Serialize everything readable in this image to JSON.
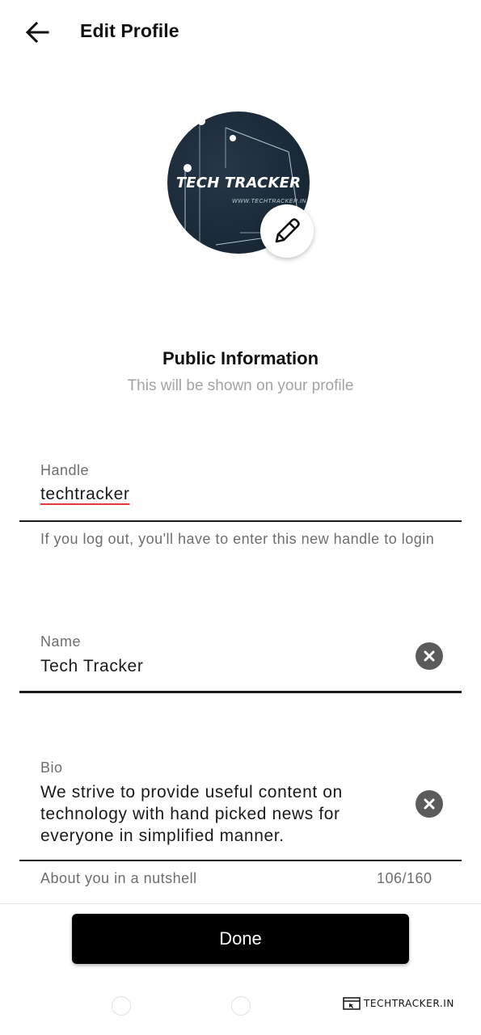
{
  "header": {
    "title": "Edit Profile",
    "back_icon": "arrow-left-icon"
  },
  "avatar": {
    "brand_text": "TECH TRACKER",
    "url_text": "WWW.TECHTRACKER.IN",
    "edit_icon": "pencil-icon"
  },
  "public_info": {
    "title": "Public Information",
    "subtitle": "This will be shown on your profile"
  },
  "handle": {
    "label": "Handle",
    "value": "techtracker",
    "helper": "If you log out, you'll have to enter this new handle to login"
  },
  "name": {
    "label": "Name",
    "value": "Tech Tracker",
    "clear_icon": "clear-icon"
  },
  "bio": {
    "label": "Bio",
    "value": "We strive to provide useful content on technology with hand picked news for everyone in simplified manner.",
    "helper": "About you in a nutshell",
    "counter": "106/160",
    "clear_icon": "clear-icon"
  },
  "footer": {
    "done_label": "Done"
  },
  "watermark": {
    "text": "TECHTRACKER.IN"
  },
  "colors": {
    "accent": "#000000",
    "avatar_bg": "#1b2a38",
    "spell_underline": "#e53935",
    "muted_text": "#6e6e6e",
    "subtitle_text": "#a3a3a3",
    "clear_button": "#5b5b5b"
  }
}
